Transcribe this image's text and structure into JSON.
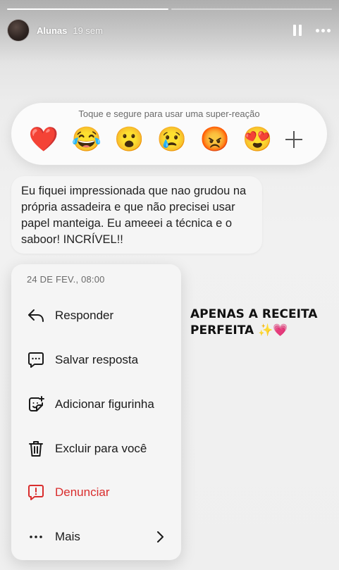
{
  "story": {
    "progress": [
      1,
      0
    ],
    "username": "Alunas",
    "time": "19 sem"
  },
  "reactions": {
    "hint": "Toque e segure para usar uma super-reação",
    "emojis": [
      "❤️",
      "😂",
      "😮",
      "😢",
      "😡",
      "😍"
    ]
  },
  "message": {
    "text": "Eu fiquei impressionada que nao grudou na própria assadeira e que não precisei usar papel manteiga. Eu ameeei a técnica e o saboor! INCRÍVEL!!"
  },
  "menu": {
    "date": "24 DE FEV., 08:00",
    "items": [
      {
        "label": "Responder",
        "icon": "reply-icon"
      },
      {
        "label": "Salvar resposta",
        "icon": "saved-reply-icon"
      },
      {
        "label": "Adicionar figurinha",
        "icon": "sticker-icon"
      },
      {
        "label": "Excluir para você",
        "icon": "trash-icon"
      },
      {
        "label": "Denunciar",
        "icon": "report-icon",
        "color": "#d92d2d"
      },
      {
        "label": "Mais",
        "icon": "more-icon"
      }
    ]
  },
  "overlay": {
    "text": "APENAS A RECEITA PERFEITA ✨💗"
  }
}
